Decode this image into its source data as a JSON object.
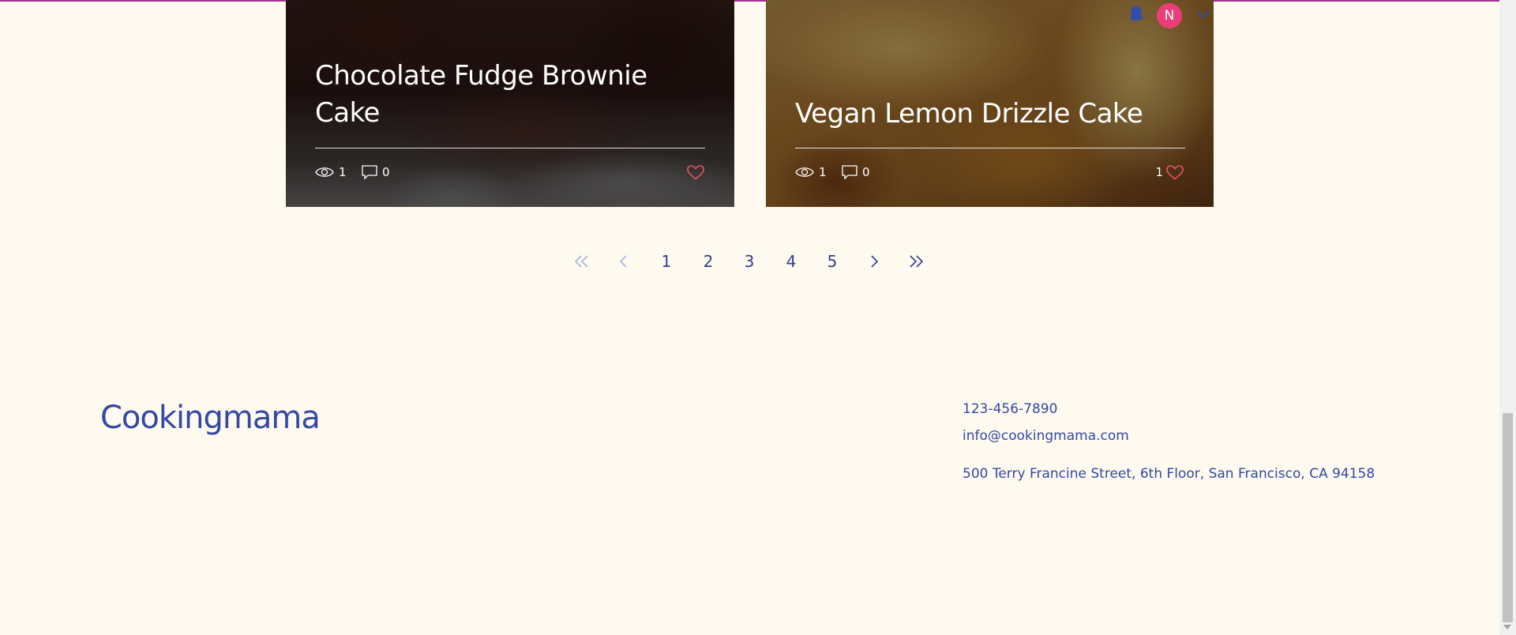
{
  "header": {
    "avatar_initial": "N",
    "accent_color": "#a52f8f"
  },
  "posts": [
    {
      "title": "Chocolate Fudge Brownie Cake",
      "views": "1",
      "comments": "0",
      "likes": ""
    },
    {
      "title": "Vegan Lemon Drizzle Cake",
      "views": "1",
      "comments": "0",
      "likes": "1"
    }
  ],
  "pagination": {
    "pages": [
      "1",
      "2",
      "3",
      "4",
      "5"
    ],
    "current": "1"
  },
  "footer": {
    "brand": "Cookingmama",
    "phone": "123-456-7890",
    "email": "info@cookingmama.com",
    "address": "500 Terry Francine Street, 6th Floor, San Francisco, CA 94158"
  }
}
